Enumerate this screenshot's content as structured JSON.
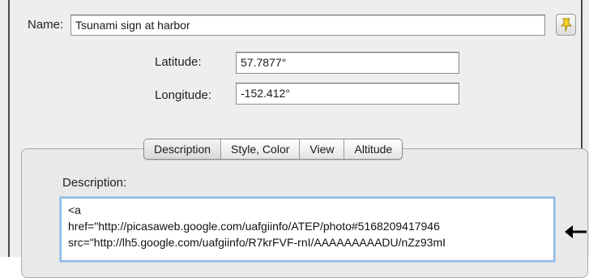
{
  "name": {
    "label": "Name:",
    "value": "Tsunami sign at harbor"
  },
  "pin_button": {
    "icon": "pushpin-icon",
    "color": "#f2d22a"
  },
  "latitude": {
    "label": "Latitude:",
    "value": "57.7877°"
  },
  "longitude": {
    "label": "Longitude:",
    "value": "-152.412°"
  },
  "tabs": [
    {
      "label": "Description",
      "selected": true
    },
    {
      "label": "Style, Color",
      "selected": false
    },
    {
      "label": "View",
      "selected": false
    },
    {
      "label": "Altitude",
      "selected": false
    }
  ],
  "description": {
    "label": "Description:",
    "lines": [
      "<a",
      "href=\"http://picasaweb.google.com/uafgiinfo/ATEP/photo#5168209417946",
      "src=\"http://lh5.google.com/uafgiinfo/R7krFVF-rnI/AAAAAAAAADU/nZz93mI"
    ]
  },
  "pointer_arrow": {
    "icon": "left-arrow-icon"
  }
}
